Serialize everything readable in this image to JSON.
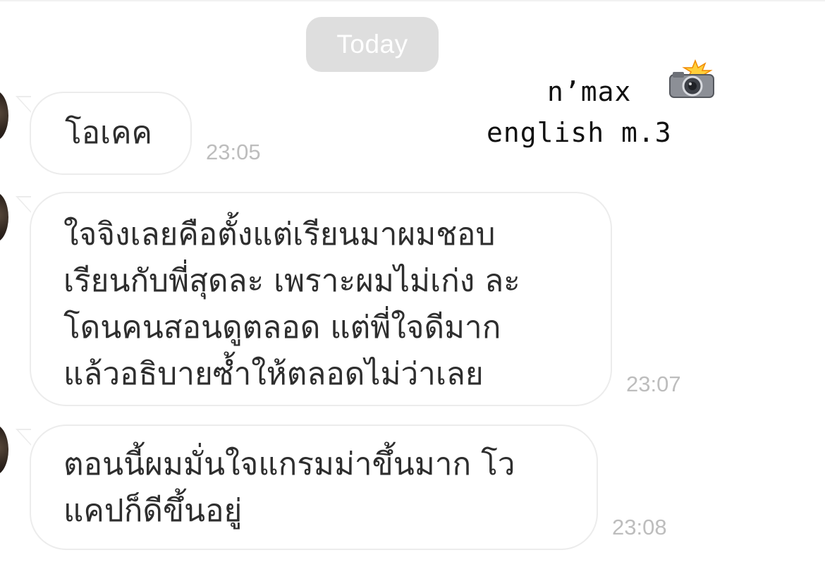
{
  "date_divider": "Today",
  "caption": {
    "line1": "n’max",
    "line2": "english m.3",
    "icon": "camera-with-flash-icon"
  },
  "messages": [
    {
      "text": "โอเคค",
      "time": "23:05"
    },
    {
      "text": "ใจจิงเลยคือตั้งแต่เรียนมาผมชอบ\nเรียนกับพี่สุดละ เพราะผมไม่เก่ง ละ\nโดนคนสอนดูตลอด แต่พี่ใจดีมาก\nแล้วอธิบายซ้ำให้ตลอดไม่ว่าเลย",
      "time": "23:07"
    },
    {
      "text": "ตอนนี้ผมมั่นใจแกรมม่าขึ้นมาก โว\nแคปก็ดีขึ้นอยู่",
      "time": "23:08"
    }
  ]
}
